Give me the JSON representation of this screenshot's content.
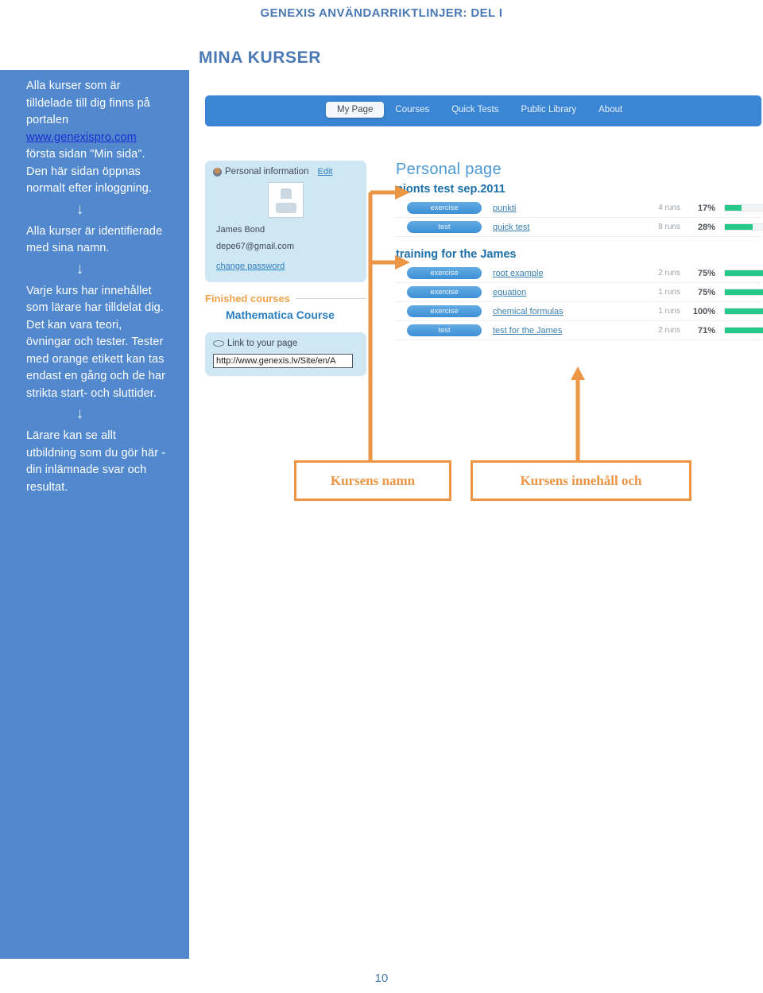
{
  "document": {
    "header_title": "GENEXIS ANVÄNDARRIKTLINJER: DEL I",
    "page_number": "10",
    "section_title": "MINA KURSER"
  },
  "colors": {
    "sidebar_blue": "#5289ce",
    "accent_blue": "#4a79b5",
    "annotation_orange": "#eb9545",
    "progress_green": "#27c98a",
    "app_nav_blue": "#3a86d4",
    "panel_blue": "#cfe6f3"
  },
  "sidebar": {
    "paragraphs": [
      {
        "before_link": "Alla kurser som är tilldelade till dig finns på portalen ",
        "link": "www.genexispro.com",
        "after_link": " första sidan \"Min sida\". Den här sidan öppnas normalt efter inloggning."
      },
      {
        "text": "Alla kurser är identifierade med sina namn."
      },
      {
        "text": "Varje kurs har innehållet som lärare har tilldelat dig. Det kan vara teori, övningar och tester. Tester med orange etikett kan tas endast en gång och de har strikta start- och sluttider."
      },
      {
        "text": "Lärare kan se allt utbildning som du gör här - din inlämnade svar och resultat."
      }
    ],
    "arrow_glyph": "↓"
  },
  "app": {
    "nav": {
      "tabs": [
        {
          "label": "My Page",
          "active": true
        },
        {
          "label": "Courses",
          "active": false
        },
        {
          "label": "Quick Tests",
          "active": false
        },
        {
          "label": "Public Library",
          "active": false
        },
        {
          "label": "About",
          "active": false
        }
      ]
    },
    "personal_information": {
      "panel_title": "Personal information",
      "edit_label": "Edit",
      "name": "James Bond",
      "email": "depe67@gmail.com",
      "change_password_label": "change password"
    },
    "finished_courses": {
      "heading": "Finished courses",
      "course": "Mathematica Course"
    },
    "link_panel": {
      "heading": "Link to your page",
      "url_value": "http://www.genexis.lv/Site/en/A"
    },
    "personal_page": {
      "title": "Personal page",
      "courses": [
        {
          "name": "pionts test sep.2011",
          "items": [
            {
              "type": "exercise",
              "task": "punkti",
              "runs": "4 runs",
              "percent": "17%",
              "percent_value": 17
            },
            {
              "type": "test",
              "task": "quick test",
              "runs": "8 runs",
              "percent": "28%",
              "percent_value": 28
            }
          ]
        },
        {
          "name": "training for the James",
          "items": [
            {
              "type": "exercise",
              "task": "root example",
              "runs": "2 runs",
              "percent": "75%",
              "percent_value": 75
            },
            {
              "type": "exercise",
              "task": "equation",
              "runs": "1 runs",
              "percent": "75%",
              "percent_value": 75
            },
            {
              "type": "exercise",
              "task": "chemical formulas",
              "runs": "1 runs",
              "percent": "100%",
              "percent_value": 100
            },
            {
              "type": "test",
              "task": "test for the James",
              "runs": "2 runs",
              "percent": "71%",
              "percent_value": 71
            }
          ]
        }
      ]
    }
  },
  "annotations": {
    "callout_1": "Kursens namn",
    "callout_2": "Kursens innehåll och"
  }
}
